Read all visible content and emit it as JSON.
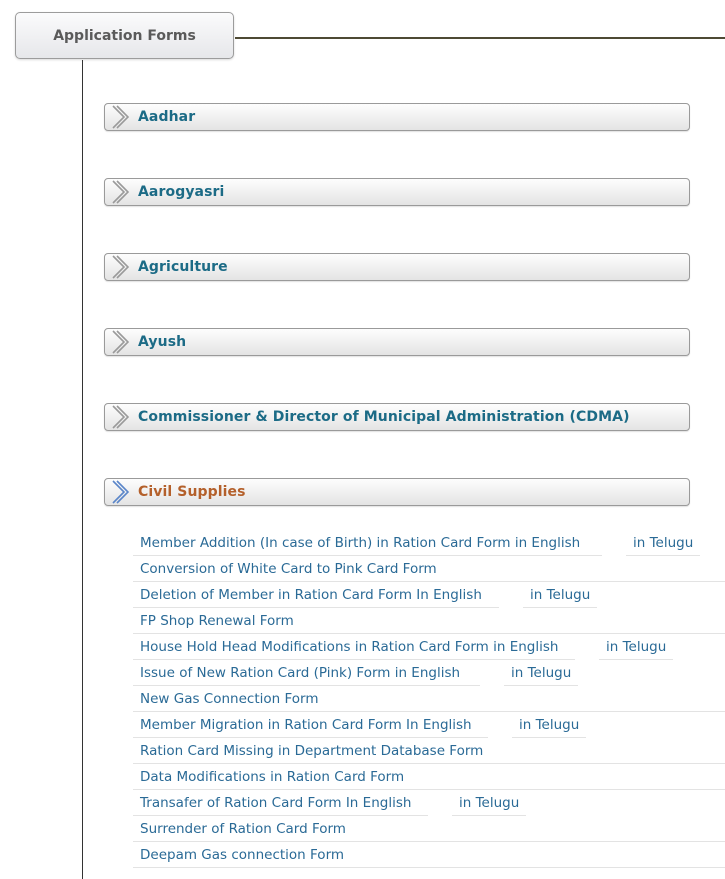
{
  "root": {
    "title": "Application Forms"
  },
  "categories": [
    {
      "label": "Aadhar",
      "active": false
    },
    {
      "label": "Aarogyasri",
      "active": false
    },
    {
      "label": "Agriculture",
      "active": false
    },
    {
      "label": "Ayush",
      "active": false
    },
    {
      "label": "Commissioner & Director of Municipal Administration (CDMA)",
      "active": false
    },
    {
      "label": "Civil Supplies",
      "active": true
    }
  ],
  "colors": {
    "category_text": "#1c6b86",
    "active_category_text": "#b4602b",
    "link_text": "#2a6a96"
  },
  "civil_supplies_forms": [
    {
      "label": "Member Addition (In case of Birth) in Ration Card Form in English",
      "telugu": "in Telugu"
    },
    {
      "label": "Conversion of White Card to Pink Card Form"
    },
    {
      "label": "Deletion of Member in Ration Card Form In English",
      "telugu": "in Telugu"
    },
    {
      "label": "FP Shop Renewal Form"
    },
    {
      "label": "House Hold Head Modifications in Ration Card Form in English",
      "telugu": "in Telugu"
    },
    {
      "label": "Issue of New Ration Card (Pink) Form in English",
      "telugu": "in Telugu"
    },
    {
      "label": "New Gas Connection Form"
    },
    {
      "label": "Member Migration in Ration Card Form In English",
      "telugu": "in Telugu"
    },
    {
      "label": "Ration Card Missing in Department Database Form"
    },
    {
      "label": "Data Modifications in Ration Card Form"
    },
    {
      "label": "Transafer of Ration Card Form In English",
      "telugu": "in Telugu"
    },
    {
      "label": "Surrender of Ration Card Form"
    },
    {
      "label": "Deepam Gas connection Form"
    }
  ]
}
